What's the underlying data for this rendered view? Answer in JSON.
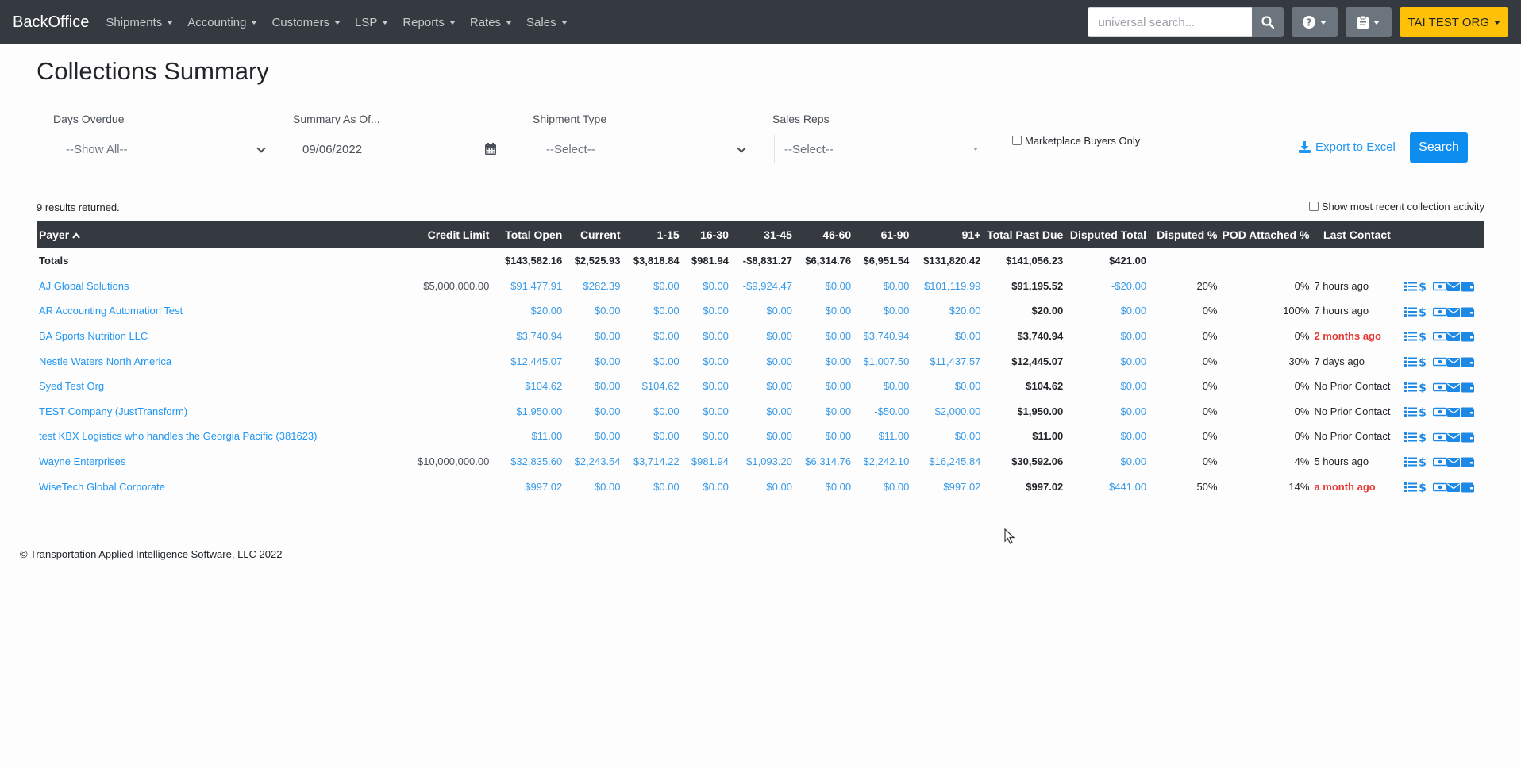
{
  "navbar": {
    "brand": "BackOffice",
    "menu": [
      "Shipments",
      "Accounting",
      "Customers",
      "LSP",
      "Reports",
      "Rates",
      "Sales"
    ],
    "search_placeholder": "universal search...",
    "org_label": "TAI TEST ORG",
    "bg_color": "#343a40",
    "org_color": "#ffc107"
  },
  "page": {
    "title": "Collections Summary"
  },
  "filters": {
    "days_overdue": {
      "label": "Days Overdue",
      "value": "--Show All--"
    },
    "summary_as_of": {
      "label": "Summary As Of...",
      "value": "09/06/2022"
    },
    "shipment_type": {
      "label": "Shipment Type",
      "value": "--Select--"
    },
    "sales_reps": {
      "label": "Sales Reps",
      "value": "--Select--"
    },
    "marketplace_label": "Marketplace Buyers Only",
    "export_label": "Export to Excel",
    "search_label": "Search"
  },
  "results_text": "9 results returned.",
  "recent_label": "Show most recent collection activity",
  "table": {
    "headers": [
      "Payer",
      "Credit Limit",
      "Total Open",
      "Current",
      "1-15",
      "16-30",
      "31-45",
      "46-60",
      "61-90",
      "91+",
      "Total Past Due",
      "Disputed Total",
      "Disputed %",
      "POD Attached %",
      "Last Contact"
    ],
    "totals": {
      "label": "Totals",
      "total_open": "$143,582.16",
      "current": "$2,525.93",
      "d1_15": "$3,818.84",
      "d16_30": "$981.94",
      "d31_45": "-$8,831.27",
      "d46_60": "$6,314.76",
      "d61_90": "$6,951.54",
      "d91": "$131,820.42",
      "total_past_due": "$141,056.23",
      "disputed_total": "$421.00"
    },
    "rows": [
      {
        "payer": "AJ Global Solutions",
        "credit_limit": "$5,000,000.00",
        "total_open": "$91,477.91",
        "current": "$282.39",
        "d1_15": "$0.00",
        "d16_30": "$0.00",
        "d31_45": "-$9,924.47",
        "d46_60": "$0.00",
        "d61_90": "$0.00",
        "d91": "$101,119.99",
        "total_past_due": "$91,195.52",
        "disputed_total": "-$20.00",
        "disputed_pct": "20%",
        "pod_pct": "0%",
        "last_contact": "7 hours ago",
        "alert": false
      },
      {
        "payer": "AR Accounting Automation Test",
        "credit_limit": "",
        "total_open": "$20.00",
        "current": "$0.00",
        "d1_15": "$0.00",
        "d16_30": "$0.00",
        "d31_45": "$0.00",
        "d46_60": "$0.00",
        "d61_90": "$0.00",
        "d91": "$20.00",
        "total_past_due": "$20.00",
        "disputed_total": "$0.00",
        "disputed_pct": "0%",
        "pod_pct": "100%",
        "last_contact": "7 hours ago",
        "alert": false
      },
      {
        "payer": "BA Sports Nutrition LLC",
        "credit_limit": "",
        "total_open": "$3,740.94",
        "current": "$0.00",
        "d1_15": "$0.00",
        "d16_30": "$0.00",
        "d31_45": "$0.00",
        "d46_60": "$0.00",
        "d61_90": "$3,740.94",
        "d91": "$0.00",
        "total_past_due": "$3,740.94",
        "disputed_total": "$0.00",
        "disputed_pct": "0%",
        "pod_pct": "0%",
        "last_contact": "2 months ago",
        "alert": true
      },
      {
        "payer": "Nestle Waters North America",
        "credit_limit": "",
        "total_open": "$12,445.07",
        "current": "$0.00",
        "d1_15": "$0.00",
        "d16_30": "$0.00",
        "d31_45": "$0.00",
        "d46_60": "$0.00",
        "d61_90": "$1,007.50",
        "d91": "$11,437.57",
        "total_past_due": "$12,445.07",
        "disputed_total": "$0.00",
        "disputed_pct": "0%",
        "pod_pct": "30%",
        "last_contact": "7 days ago",
        "alert": false
      },
      {
        "payer": "Syed Test Org",
        "credit_limit": "",
        "total_open": "$104.62",
        "current": "$0.00",
        "d1_15": "$104.62",
        "d16_30": "$0.00",
        "d31_45": "$0.00",
        "d46_60": "$0.00",
        "d61_90": "$0.00",
        "d91": "$0.00",
        "total_past_due": "$104.62",
        "disputed_total": "$0.00",
        "disputed_pct": "0%",
        "pod_pct": "0%",
        "last_contact": "No Prior Contact",
        "alert": false
      },
      {
        "payer": "TEST Company (JustTransform)",
        "credit_limit": "",
        "total_open": "$1,950.00",
        "current": "$0.00",
        "d1_15": "$0.00",
        "d16_30": "$0.00",
        "d31_45": "$0.00",
        "d46_60": "$0.00",
        "d61_90": "-$50.00",
        "d91": "$2,000.00",
        "total_past_due": "$1,950.00",
        "disputed_total": "$0.00",
        "disputed_pct": "0%",
        "pod_pct": "0%",
        "last_contact": "No Prior Contact",
        "alert": false
      },
      {
        "payer": "test KBX Logistics who handles the Georgia Pacific (381623)",
        "credit_limit": "",
        "total_open": "$11.00",
        "current": "$0.00",
        "d1_15": "$0.00",
        "d16_30": "$0.00",
        "d31_45": "$0.00",
        "d46_60": "$0.00",
        "d61_90": "$11.00",
        "d91": "$0.00",
        "total_past_due": "$11.00",
        "disputed_total": "$0.00",
        "disputed_pct": "0%",
        "pod_pct": "0%",
        "last_contact": "No Prior Contact",
        "alert": false
      },
      {
        "payer": "Wayne Enterprises",
        "credit_limit": "$10,000,000.00",
        "total_open": "$32,835.60",
        "current": "$2,243.54",
        "d1_15": "$3,714.22",
        "d16_30": "$981.94",
        "d31_45": "$1,093.20",
        "d46_60": "$6,314.76",
        "d61_90": "$2,242.10",
        "d91": "$16,245.84",
        "total_past_due": "$30,592.06",
        "disputed_total": "$0.00",
        "disputed_pct": "0%",
        "pod_pct": "4%",
        "last_contact": "5 hours ago",
        "alert": false
      },
      {
        "payer": "WiseTech Global Corporate",
        "credit_limit": "",
        "total_open": "$997.02",
        "current": "$0.00",
        "d1_15": "$0.00",
        "d16_30": "$0.00",
        "d31_45": "$0.00",
        "d46_60": "$0.00",
        "d61_90": "$0.00",
        "d91": "$997.02",
        "total_past_due": "$997.02",
        "disputed_total": "$441.00",
        "disputed_pct": "50%",
        "pod_pct": "14%",
        "last_contact": "a month ago",
        "alert": true
      }
    ]
  },
  "footer": "© Transportation Applied Intelligence Software, LLC 2022",
  "colors": {
    "link": "#2196f3",
    "primary": "#0d8df0",
    "alert": "#e53935"
  }
}
